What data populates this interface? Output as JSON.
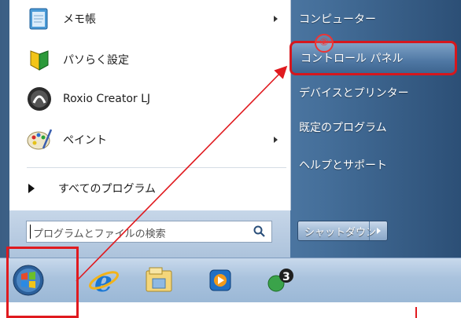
{
  "left_panel": {
    "programs": [
      {
        "label": "メモ帳",
        "icon": "notepad-icon",
        "has_submenu": true
      },
      {
        "label": "パソらく設定",
        "icon": "shield-icon",
        "has_submenu": false
      },
      {
        "label": "Roxio Creator LJ",
        "icon": "roxio-icon",
        "has_submenu": false
      },
      {
        "label": "ペイント",
        "icon": "paint-palette-icon",
        "has_submenu": true
      }
    ],
    "all_programs_label": "すべてのプログラム",
    "search_placeholder": "プログラムとファイルの検索"
  },
  "right_panel": {
    "items": [
      {
        "label": "コンピューター"
      },
      {
        "label": "コントロール パネル"
      },
      {
        "label": "デバイスとプリンター"
      },
      {
        "label": "既定のプログラム"
      },
      {
        "label": "ヘルプとサポート"
      }
    ],
    "shutdown_label": "シャットダウン"
  },
  "annotation": {
    "step_number": "②",
    "highlight_color": "#e01a1f"
  },
  "taskbar": {
    "icons": [
      "start-orb-icon",
      "internet-explorer-icon",
      "file-explorer-icon",
      "media-player-icon",
      "solitaire-icon"
    ]
  },
  "colors": {
    "menu_frame": "#456f9a",
    "taskbar": "#a9c2dd",
    "annotation_red": "#e01a1f"
  }
}
